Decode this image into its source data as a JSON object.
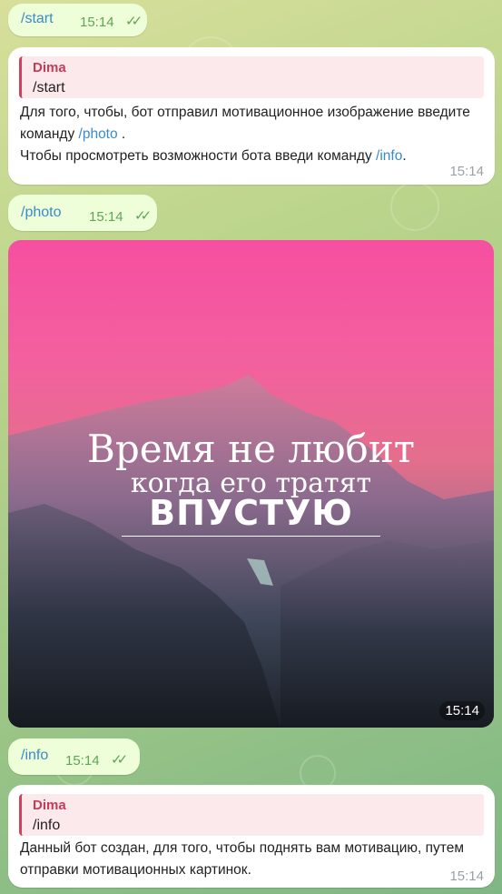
{
  "messages": [
    {
      "type": "outgoing",
      "text": "/start",
      "time": "15:14"
    },
    {
      "type": "incoming",
      "quote_name": "Dima",
      "quote_text": "/start",
      "body_part1": "Для того, чтобы, бот отправил мотивационное изображение введите команду ",
      "body_link1": "/photo",
      "body_part2": " .",
      "body_part3": "Чтобы просмотреть возможности бота введи команду ",
      "body_link2": "/info",
      "body_part4": ".",
      "time": "15:14"
    },
    {
      "type": "outgoing",
      "text": "/photo",
      "time": "15:14"
    },
    {
      "type": "photo",
      "caption_line1": "Время не любит",
      "caption_line2": "когда его тратят",
      "caption_line3": "ВПУСТУЮ",
      "time": "15:14"
    },
    {
      "type": "outgoing",
      "text": "/info",
      "time": "15:14"
    },
    {
      "type": "incoming",
      "quote_name": "Dima",
      "quote_text": "/info",
      "body": "Данный бот создан, для того, чтобы поднять вам мотивацию, путем отправки мотивационных картинок.",
      "time": "15:14"
    }
  ],
  "icons": {
    "read_receipt": "double-check-icon"
  },
  "colors": {
    "link": "#3a8bc9",
    "quote_border": "#d0415d",
    "quote_name": "#c43d58",
    "outgoing_bg": "#eefed9"
  }
}
